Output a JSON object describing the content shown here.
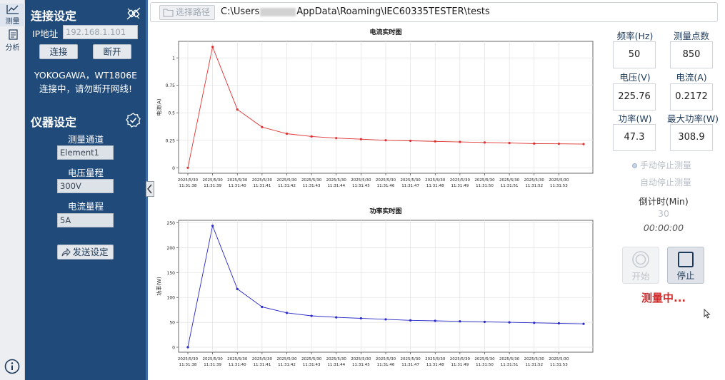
{
  "nav": {
    "measure_label": "测量",
    "analysis_label": "分析"
  },
  "connection": {
    "title": "连接设定",
    "ip_label": "IP地址",
    "ip_value": "192.168.1.101",
    "connect_label": "连接",
    "disconnect_label": "断开",
    "device_text": "YOKOGAWA，WT1806E",
    "status_text": "连接中，请勿断开网线!"
  },
  "instrument": {
    "title": "仪器设定",
    "channel_label": "测量通道",
    "channel_value": "Element1",
    "voltage_range_label": "电压量程",
    "voltage_range_value": "300V",
    "current_range_label": "电流量程",
    "current_range_value": "5A",
    "send_label": "发送设定"
  },
  "path_bar": {
    "choose_label": "选择路径",
    "path_prefix": "C:\\Users",
    "path_suffix": "AppData\\Roaming\\IEC60335TESTER\\tests"
  },
  "readings": {
    "freq_label": "频率(Hz)",
    "freq_value": "50",
    "points_label": "测量点数",
    "points_value": "850",
    "voltage_label": "电压(V)",
    "voltage_value": "225.76",
    "current_label": "电流(A)",
    "current_value": "0.2172",
    "power_label": "功率(W)",
    "power_value": "47.3",
    "max_power_label": "最大功率(W)",
    "max_power_value": "308.9"
  },
  "controls": {
    "manual_stop_label": "手动停止测量",
    "auto_stop_label": "自动停止测量",
    "countdown_label": "倒计时(Min)",
    "countdown_value": "30",
    "timer_value": "00:00:00",
    "start_label": "开始",
    "stop_label": "停止",
    "status_text": "测量中..."
  },
  "colors": {
    "sidebar_bg": "#1f4a7a",
    "current_series": "#e03030",
    "power_series": "#2828c8",
    "status_red": "#d12b2b"
  },
  "chart_data": [
    {
      "type": "line",
      "title": "电流实时图",
      "xlabel": "",
      "ylabel": "电流(A)",
      "ylim": [
        -0.05,
        1.15
      ],
      "yticks": [
        0,
        0.25,
        0.5,
        0.75,
        1
      ],
      "ytick_labels": [
        "0",
        "0.25",
        "0.5",
        "0.75",
        "1"
      ],
      "grid": true,
      "x_dates": [
        "2025/5/30",
        "2025/5/30",
        "2025/5/30",
        "2025/5/30",
        "2025/5/30",
        "2025/5/30",
        "2025/5/30",
        "2025/5/30",
        "2025/5/30",
        "2025/5/30",
        "2025/5/30",
        "2025/5/30",
        "2025/5/30",
        "2025/5/30",
        "2025/5/30",
        "2025/5/30"
      ],
      "x_times": [
        "11:31:38",
        "11:31:39",
        "11:31:40",
        "11:31:41",
        "11:31:42",
        "11:31:43",
        "11:31:44",
        "11:31:45",
        "11:31:46",
        "11:31:47",
        "11:31:48",
        "11:31:49",
        "11:31:50",
        "11:31:51",
        "11:31:52",
        "11:31:53"
      ],
      "series": [
        {
          "values": [
            0,
            1.1,
            0.53,
            0.37,
            0.31,
            0.285,
            0.27,
            0.26,
            0.25,
            0.245,
            0.24,
            0.235,
            0.23,
            0.225,
            0.22,
            0.218,
            0.215
          ]
        }
      ]
    },
    {
      "type": "line",
      "title": "功率实时图",
      "xlabel": "",
      "ylabel": "功率(W)",
      "ylim": [
        -10,
        255
      ],
      "yticks": [
        0,
        50,
        100,
        150,
        200,
        250
      ],
      "ytick_labels": [
        "0",
        "50",
        "100",
        "150",
        "200",
        "250"
      ],
      "grid": true,
      "x_dates": [
        "2025/5/30",
        "2025/5/30",
        "2025/5/30",
        "2025/5/30",
        "2025/5/30",
        "2025/5/30",
        "2025/5/30",
        "2025/5/30",
        "2025/5/30",
        "2025/5/30",
        "2025/5/30",
        "2025/5/30",
        "2025/5/30",
        "2025/5/30",
        "2025/5/30",
        "2025/5/30"
      ],
      "x_times": [
        "11:31:38",
        "11:31:39",
        "11:31:40",
        "11:31:41",
        "11:31:42",
        "11:31:43",
        "11:31:44",
        "11:31:45",
        "11:31:46",
        "11:31:47",
        "11:31:48",
        "11:31:49",
        "11:31:50",
        "11:31:51",
        "11:31:52",
        "11:31:53"
      ],
      "series": [
        {
          "values": [
            0,
            244,
            117,
            81,
            69,
            63,
            60,
            58,
            56,
            54,
            53,
            52,
            51,
            50,
            49,
            48,
            47
          ]
        }
      ]
    }
  ]
}
